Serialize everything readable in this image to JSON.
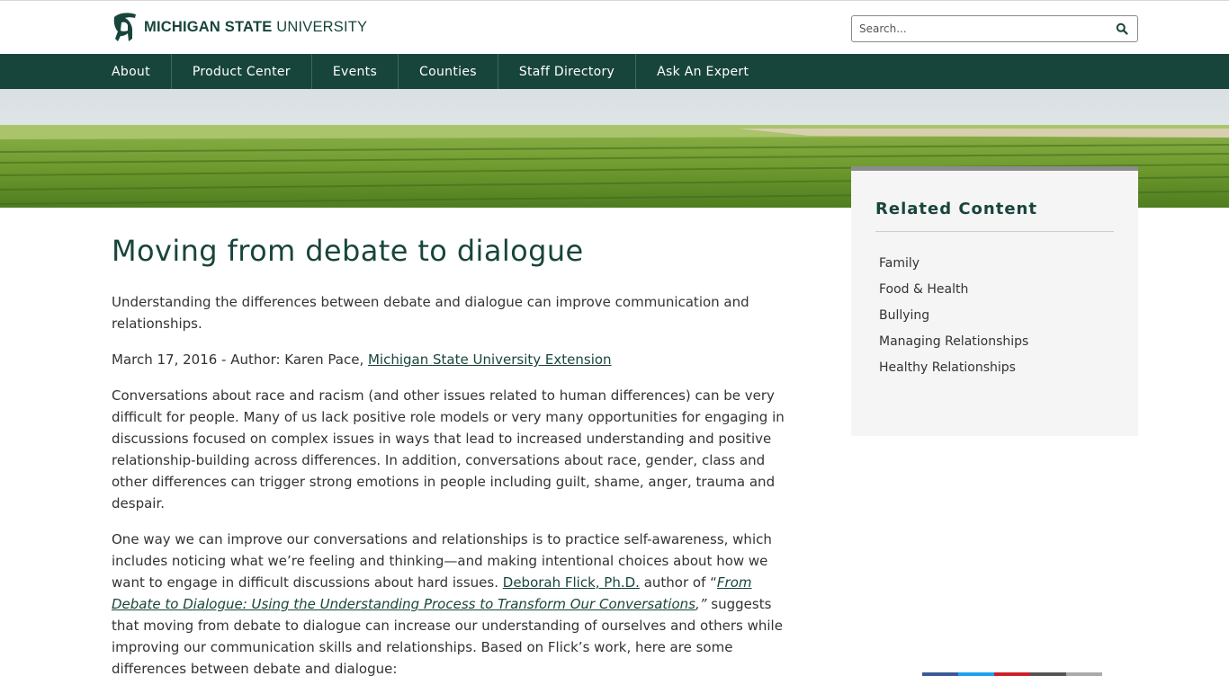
{
  "header": {
    "logo_primary": "MICHIGAN STATE",
    "logo_secondary": "UNIVERSITY",
    "search_placeholder": "Search..."
  },
  "nav": {
    "items": [
      "About",
      "Product Center",
      "Events",
      "Counties",
      "Staff Directory",
      "Ask An Expert"
    ]
  },
  "article": {
    "title": "Moving from debate to dialogue",
    "summary": "Understanding the differences between debate and dialogue can improve communication and relationships.",
    "byline_prefix": "March 17, 2016 - Author: Karen Pace, ",
    "byline_link": "Michigan State University Extension",
    "para1": "Conversations about race and racism (and other issues related to human differences) can be very difficult for people. Many of us lack positive role models or very many opportunities for engaging in discussions focused on complex issues in ways that lead to increased understanding and positive relationship-building across differences. In addition, conversations about race, gender, class and other differences can trigger strong emotions in people including guilt, shame, anger, trauma and despair.",
    "para2_a": "One way we can improve our conversations and relationships is to practice self-awareness, which includes noticing what we’re feeling and thinking—and making intentional choices about how we want to engage in difficult discussions about hard issues.  ",
    "para2_link1": "Deborah Flick, Ph.D.",
    "para2_b": " author of “",
    "para2_link2": "From Debate to Dialogue: Using the Understanding Process to Transform Our Conversations",
    "para2_c": ",”",
    "para2_d": " suggests that moving from debate to dialogue can increase our understanding of ourselves and others while improving our communication skills and relationships. Based on Flick’s work, here are some differences between debate and dialogue:"
  },
  "sidebar": {
    "heading": "Related Content",
    "items": [
      "Family",
      "Food & Health",
      "Bullying",
      "Managing Relationships",
      "Healthy Relationships"
    ]
  },
  "colors": {
    "brand_green": "#18453b",
    "nav_divider": "#3d6a5f",
    "sidebar_bg": "#f5f5f5",
    "share_colors": [
      "#3b5998",
      "#1da1f2",
      "#cb2027",
      "#555555",
      "#aaaaaa"
    ]
  },
  "icons": {
    "logo": "spartan-helmet-icon",
    "search": "magnifier-icon"
  }
}
